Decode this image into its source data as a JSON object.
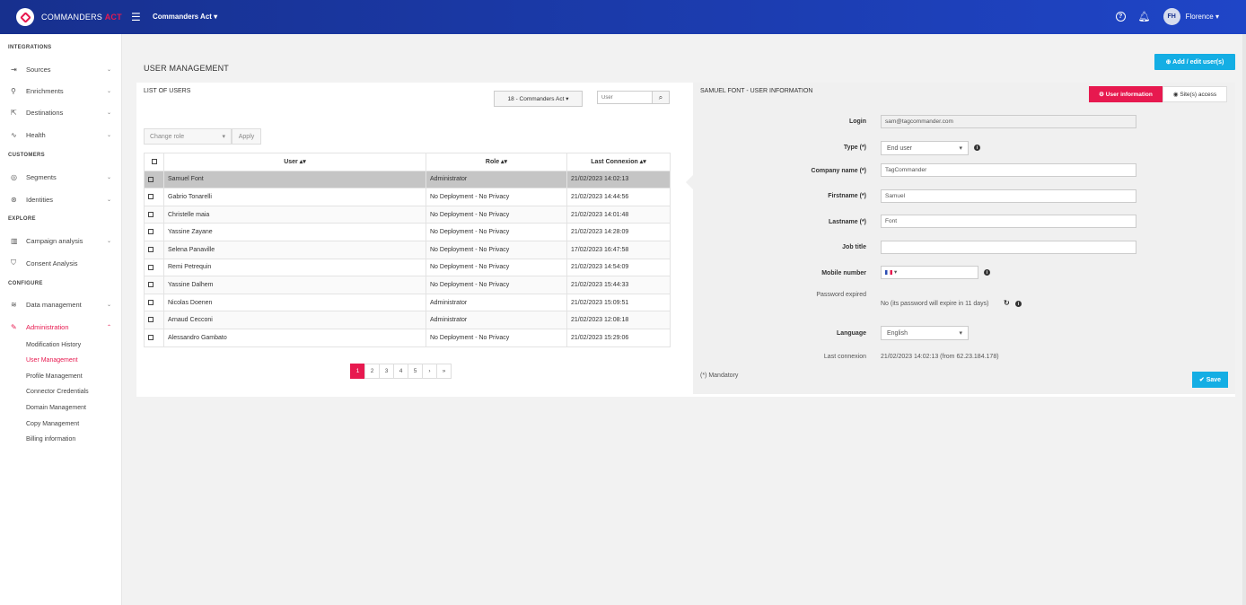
{
  "brand": {
    "name_part1": "COMMANDERS",
    "name_part2": "ACT"
  },
  "topbar": {
    "account": "Commanders Act ▾",
    "avatar_initials": "FH",
    "user_name": "Florence ▾"
  },
  "sidebar": {
    "sections": {
      "integrations": "INTEGRATIONS",
      "customers": "CUSTOMERS",
      "explore": "EXPLORE",
      "configure": "CONFIGURE"
    },
    "items": {
      "sources": "Sources",
      "enrichments": "Enrichments",
      "destinations": "Destinations",
      "health": "Health",
      "segments": "Segments",
      "identities": "Identities",
      "campaign": "Campaign analysis",
      "consent": "Consent Analysis",
      "data_mgmt": "Data management",
      "administration": "Administration"
    },
    "subitems": [
      "Modification History",
      "User Management",
      "Profile Management",
      "Connector Credentials",
      "Domain Management",
      "Copy Management",
      "Billing information"
    ]
  },
  "main": {
    "title": "USER MANAGEMENT",
    "add_button": "⊕  Add / edit user(s)"
  },
  "list": {
    "title": "LIST OF USERS",
    "site_select": "18 - Commanders Act ▾",
    "search_placeholder": "User",
    "role_select": "Change role",
    "apply": "Apply",
    "headers": {
      "user": "User ▴▾",
      "role": "Role ▴▾",
      "last": "Last Connexion ▴▾"
    },
    "rows": [
      {
        "user": "Samuel Font",
        "role": "Administrator",
        "last": "21/02/2023 14:02:13"
      },
      {
        "user": "Gabrio Tonarelli",
        "role": "No Deployment - No Privacy",
        "last": "21/02/2023 14:44:56"
      },
      {
        "user": "Christelle maia",
        "role": "No Deployment - No Privacy",
        "last": "21/02/2023 14:01:48"
      },
      {
        "user": "Yassine Zayane",
        "role": "No Deployment - No Privacy",
        "last": "21/02/2023 14:28:09"
      },
      {
        "user": "Selena Panaville",
        "role": "No Deployment - No Privacy",
        "last": "17/02/2023 16:47:58"
      },
      {
        "user": "Remi Petrequin",
        "role": "No Deployment - No Privacy",
        "last": "21/02/2023 14:54:09"
      },
      {
        "user": "Yassine Dalhem",
        "role": "No Deployment - No Privacy",
        "last": "21/02/2023 15:44:33"
      },
      {
        "user": "Nicolas Doenen",
        "role": "Administrator",
        "last": "21/02/2023 15:09:51"
      },
      {
        "user": "Arnaud Cecconi",
        "role": "Administrator",
        "last": "21/02/2023 12:08:18"
      },
      {
        "user": "Alessandro Gambato",
        "role": "No Deployment - No Privacy",
        "last": "21/02/2023 15:29:06"
      }
    ],
    "pages": [
      "1",
      "2",
      "3",
      "4",
      "5",
      "›",
      "»"
    ]
  },
  "info": {
    "title": "SAMUEL FONT - USER INFORMATION",
    "tab_user": "⚙ User information",
    "tab_site": "◉ Site(s) access",
    "labels": {
      "login": "Login",
      "type": "Type (*)",
      "company": "Company name (*)",
      "firstname": "Firstname (*)",
      "lastname": "Lastname (*)",
      "job": "Job title",
      "mobile": "Mobile number",
      "pwd": "Password expired",
      "language": "Language",
      "last": "Last connexion"
    },
    "values": {
      "login": "sam@tagcommander.com",
      "type": "End user",
      "company": "TagCommander",
      "firstname": "Samuel",
      "lastname": "Font",
      "job": "",
      "mobile_suffix": "▾",
      "pwd": "No (its password will expire in 11 days)",
      "language": "English",
      "last": "21/02/2023 14:02:13 (from 62.23.184.178)"
    },
    "mandatory": "(*) Mandatory",
    "save": "✔ Save"
  }
}
